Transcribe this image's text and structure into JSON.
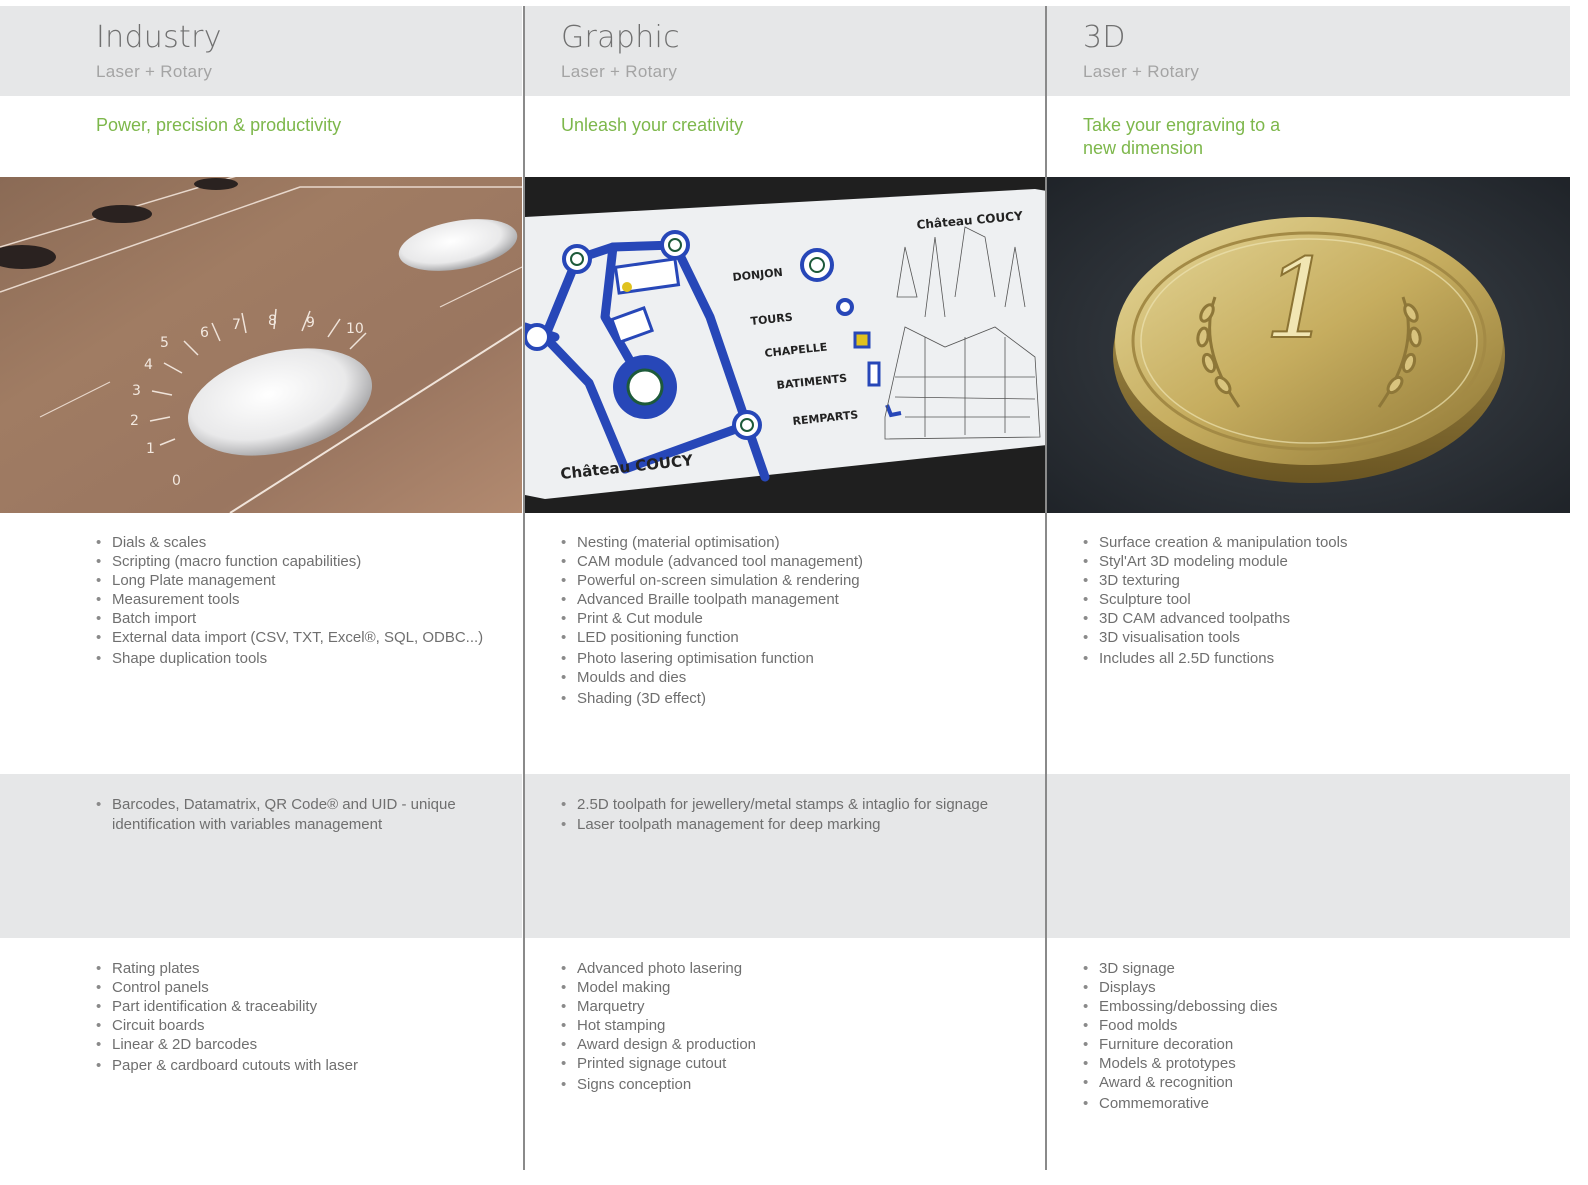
{
  "columns": [
    {
      "title": "Industry",
      "subtitle": "Laser + Rotary",
      "tagline": "Power, precision & productivity",
      "features": [
        "Dials & scales",
        "Scripting (macro function capabilities)",
        "Long Plate management",
        "Measurement tools",
        "Batch import",
        "External data import (CSV, TXT, Excel®, SQL, ODBC...)",
        "Shape duplication tools"
      ],
      "extras": [
        "Barcodes, Datamatrix, QR Code® and UID - unique identification with variables management"
      ],
      "applications": [
        "Rating plates",
        "Control panels",
        "Part identification & traceability",
        "Circuit boards",
        "Linear & 2D barcodes",
        "Paper & cardboard cutouts with laser"
      ]
    },
    {
      "title": "Graphic",
      "subtitle": "Laser + Rotary",
      "tagline": "Unleash your creativity",
      "features": [
        "Nesting (material optimisation)",
        "CAM module (advanced tool management)",
        "Powerful on-screen simulation & rendering",
        "Advanced Braille toolpath management",
        "Print & Cut module",
        "LED positioning function",
        "Photo lasering optimisation function",
        "Moulds and dies",
        "Shading (3D effect)"
      ],
      "extras": [
        "2.5D toolpath for jewellery/metal stamps & intaglio for signage",
        "Laser toolpath management for deep marking"
      ],
      "applications": [
        "Advanced photo lasering",
        "Model making",
        "Marquetry",
        "Hot stamping",
        "Award design & production",
        "Printed signage cutout",
        "Signs conception"
      ],
      "photo_labels": {
        "brand_top": "Château COUCY",
        "brand_bottom": "Château COUCY",
        "legend": [
          "DONJON",
          "TOURS",
          "CHAPELLE",
          "BATIMENTS",
          "REMPARTS"
        ]
      }
    },
    {
      "title": "3D",
      "subtitle": "Laser + Rotary",
      "tagline": "Take your engraving to a new dimension",
      "features": [
        "Surface creation & manipulation tools",
        "Styl'Art 3D modeling module",
        "3D texturing",
        "Sculpture tool",
        "3D CAM advanced toolpaths",
        "3D visualisation tools",
        "Includes all 2.5D functions"
      ],
      "extras": [],
      "applications": [
        "3D signage",
        "Displays",
        "Embossing/debossing dies",
        "Food molds",
        "Furniture decoration",
        "Models & prototypes",
        "Award & recognition",
        "Commemorative"
      ],
      "photo_labels": {
        "coin_numeral": "1"
      }
    }
  ],
  "photo_dial_numbers": [
    "0",
    "1",
    "2",
    "3",
    "4",
    "5",
    "6",
    "7",
    "8",
    "9",
    "10"
  ],
  "colors": {
    "band": "#e6e7e8",
    "tagline": "#7db74b",
    "text": "#6f6f6f",
    "divider": "#8a8a8a"
  }
}
